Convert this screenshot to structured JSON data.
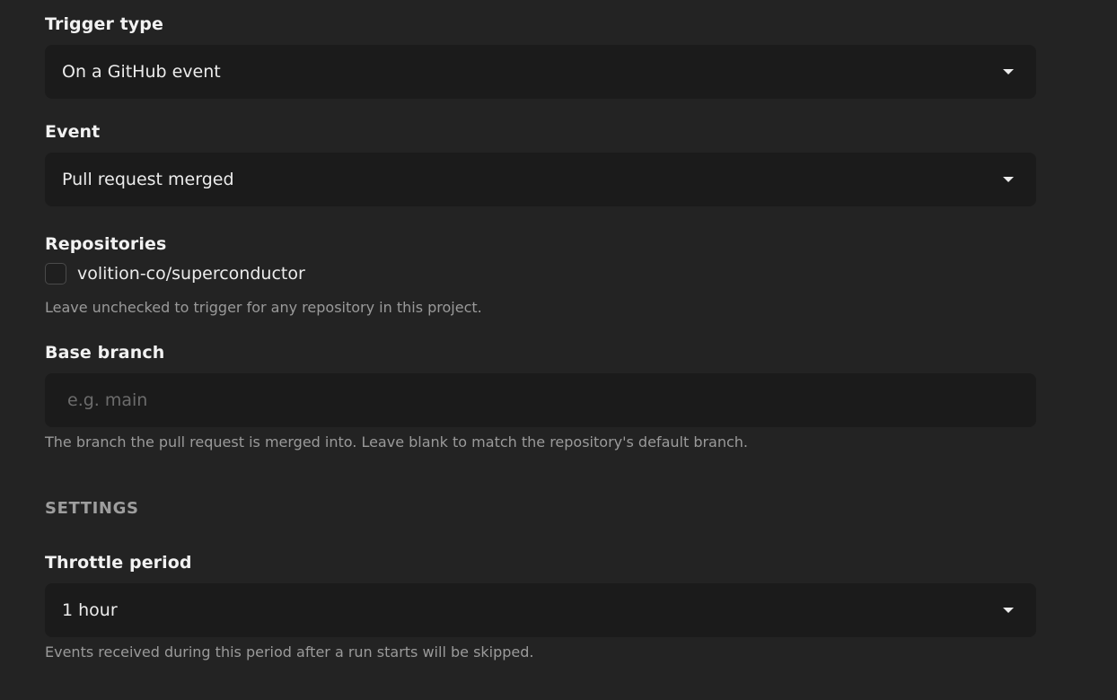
{
  "trigger_type": {
    "label": "Trigger type",
    "value": "On a GitHub event",
    "icon": "caret-down-icon"
  },
  "event": {
    "label": "Event",
    "value": "Pull request merged",
    "icon": "caret-down-icon"
  },
  "repositories": {
    "label": "Repositories",
    "items": [
      {
        "name": "volition-co/superconductor",
        "checked": false
      }
    ],
    "help": "Leave unchecked to trigger for any repository in this project."
  },
  "base_branch": {
    "label": "Base branch",
    "value": "",
    "placeholder": "e.g. main",
    "help": "The branch the pull request is merged into. Leave blank to match the repository's default branch."
  },
  "settings": {
    "heading": "SETTINGS",
    "throttle_period": {
      "label": "Throttle period",
      "value": "1 hour",
      "icon": "caret-down-icon",
      "help": "Events received during this period after a run starts will be skipped."
    }
  },
  "colors": {
    "background": "#232323",
    "field_background": "#1b1b1b",
    "label_text": "#f2f2f2",
    "help_text": "#9a9a9a",
    "section_heading": "#9e9e9e",
    "placeholder": "#6c6c6c"
  }
}
